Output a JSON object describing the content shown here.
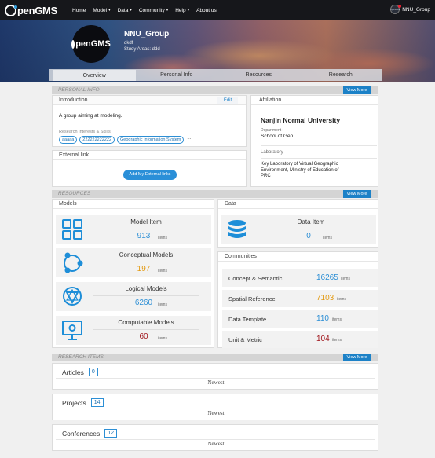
{
  "nav": {
    "logo": "penGMS",
    "menu": [
      {
        "label": "Home",
        "caret": false
      },
      {
        "label": "Model",
        "caret": true
      },
      {
        "label": "Data",
        "caret": true
      },
      {
        "label": "Community",
        "caret": true
      },
      {
        "label": "Help",
        "caret": true
      },
      {
        "label": "About us",
        "caret": false
      }
    ],
    "user": "NNU_Group",
    "avatar_text": "OpenGMS"
  },
  "profile": {
    "avatar_text": "penGMS",
    "name": "NNU_Group",
    "subtitle": "dkdf",
    "study_areas": "Study Areas: ddd"
  },
  "tabs": [
    "Overview",
    "Personal Info",
    "Resources",
    "Research"
  ],
  "personal_info": {
    "section_title": "PERSONAL INFO",
    "view_more": "View More",
    "intro_title": "Introduction",
    "edit": "Edit",
    "intro_text": "A group aiming at modeling.",
    "ri_label": "Research Interests & Skills",
    "tags": [
      "aaaaa",
      "222222222222",
      "Geographic Information System"
    ],
    "tags_more": "...",
    "external_title": "External link",
    "external_button": "Add My External links",
    "affiliation_title": "Affiliation",
    "university": "Nanjin Normal University",
    "department_label": "Department :",
    "department": "School of Geo",
    "laboratory_label": "Laboratory",
    "laboratory": "Key Laboratory of Virtual Geographic Environment, Ministry of Education of PRC"
  },
  "resources": {
    "section_title": "RESOURCES",
    "view_more": "View More",
    "models_title": "Models",
    "items_label": "items",
    "models": [
      {
        "name": "Model Item",
        "count": "913",
        "color": "#2d8fd5",
        "icon": "grid-icon"
      },
      {
        "name": "Conceptual Models",
        "count": "197",
        "color": "#e39a12",
        "icon": "network-icon"
      },
      {
        "name": "Logical Models",
        "count": "6260",
        "color": "#2d8fd5",
        "icon": "logic-icon"
      },
      {
        "name": "Computable Models",
        "count": "60",
        "color": "#a0151c",
        "icon": "monitor-gear-icon"
      }
    ],
    "data_title": "Data",
    "data_item": {
      "name": "Data Item",
      "count": "0",
      "color": "#2d8fd5",
      "icon": "database-icon"
    },
    "communities_title": "Communities",
    "communities": [
      {
        "name": "Concept & Semantic",
        "count": "16265",
        "color": "#2d8fd5"
      },
      {
        "name": "Spatial Reference",
        "count": "7103",
        "color": "#e39a12"
      },
      {
        "name": "Data Template",
        "count": "110",
        "color": "#2d8fd5"
      },
      {
        "name": "Unit & Metric",
        "count": "104",
        "color": "#a0151c"
      }
    ]
  },
  "research": {
    "section_title": "RESEARCH ITEMS",
    "view_more": "View More",
    "newest": "Newest",
    "items": [
      {
        "name": "Articles",
        "count": "0"
      },
      {
        "name": "Projects",
        "count": "14"
      },
      {
        "name": "Conferences",
        "count": "12"
      }
    ]
  }
}
